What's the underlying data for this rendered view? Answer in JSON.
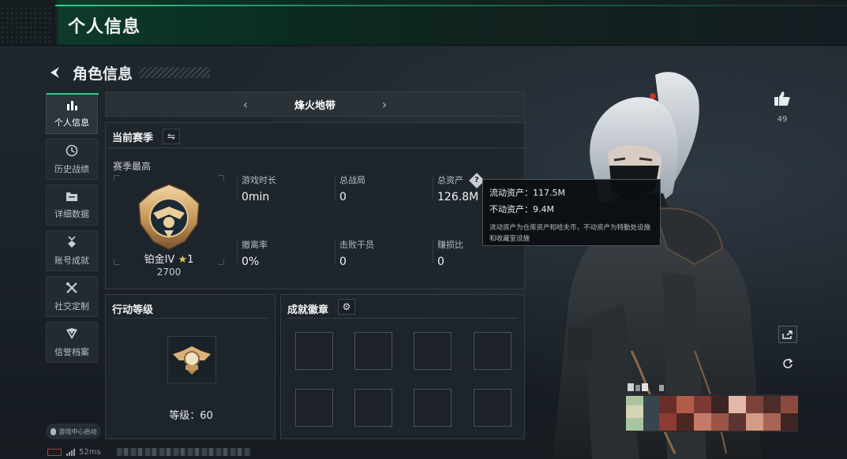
{
  "header": {
    "title": "个人信息"
  },
  "section": {
    "title": "角色信息"
  },
  "nav": {
    "items": [
      {
        "label": "个人信息",
        "icon": "bar-chart-icon",
        "glyph": "▮▮▮",
        "active": true
      },
      {
        "label": "历史战绩",
        "icon": "clock-icon",
        "glyph": "◷",
        "active": false
      },
      {
        "label": "详细数据",
        "icon": "folder-icon",
        "glyph": "▤",
        "active": false
      },
      {
        "label": "账号成就",
        "icon": "medal-icon",
        "glyph": "✪",
        "active": false
      },
      {
        "label": "社交定制",
        "icon": "tools-icon",
        "glyph": "✕",
        "active": false
      },
      {
        "label": "信誉档案",
        "icon": "shield-icon",
        "glyph": "⛉",
        "active": false
      }
    ],
    "footer": "游戏中心启动"
  },
  "mode": {
    "name": "烽火地带",
    "prev": "‹",
    "next": "›"
  },
  "season": {
    "title": "当前赛季",
    "swap_glyph": "⇋",
    "best_label": "赛季最高",
    "rank": "铂金IV",
    "stars": "1",
    "score": "2700",
    "stats": [
      {
        "key": "游戏时长",
        "value": "0min"
      },
      {
        "key": "总战局",
        "value": "0"
      },
      {
        "key": "总资产",
        "value": "126.8M"
      },
      {
        "key": "撤离率",
        "value": "0%"
      },
      {
        "key": "击败干员",
        "value": "0"
      },
      {
        "key": "赚损比",
        "value": "0"
      }
    ]
  },
  "tooltip": {
    "liquid": "流动资产：117.5M",
    "fixed": "不动资产：9.4M",
    "note": "流动资产为仓库资产和哈夫币，不动资产为特勤处设施和收藏室设施"
  },
  "level": {
    "title": "行动等级",
    "text": "等级：60"
  },
  "achievements": {
    "title": "成就徽章",
    "gear_glyph": "⚙",
    "slots": 8
  },
  "social": {
    "likes": "49"
  },
  "status": {
    "ping": "52ms"
  },
  "colors": {
    "accent": "#2fd08a",
    "gold": "#e7c46a",
    "danger": "#c13b3b"
  }
}
